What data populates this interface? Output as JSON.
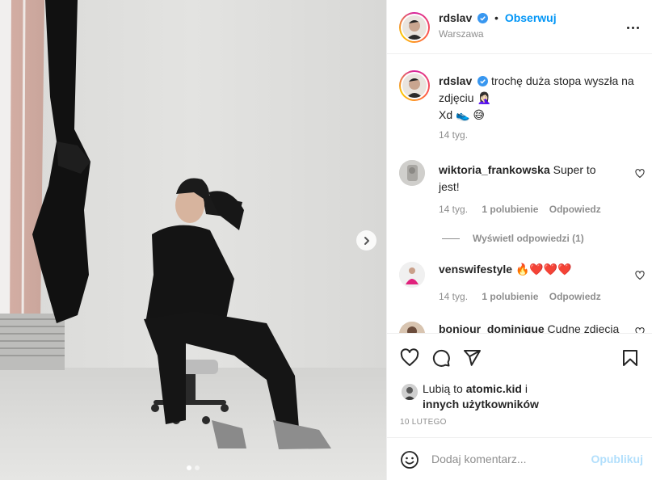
{
  "post": {
    "author": {
      "username": "rdslav",
      "verified": true,
      "follow_label": "Obserwuj",
      "separator": "•",
      "location": "Warszawa"
    },
    "caption": {
      "username": "rdslav",
      "text_line1": "trochę duża stopa wyszła na",
      "text_line2": "zdjęciu 🤦🏻‍♀️",
      "text_line3": "Xd 👟 😅",
      "time": "14 tyg."
    },
    "comments": [
      {
        "username": "wiktoria_frankowska",
        "text_line1": "Super to",
        "text_line2": "jest!",
        "time": "14 tyg.",
        "likes": "1 polubienie",
        "reply_label": "Odpowiedz",
        "view_replies": "Wyświetl odpowiedzi (1)"
      },
      {
        "username": "venswifestyle",
        "text": "🔥❤️❤️❤️",
        "time": "14 tyg.",
        "likes": "1 polubienie",
        "reply_label": "Odpowiedz"
      },
      {
        "username": "bonjour_dominique",
        "text": "Cudne zdjęcia"
      }
    ],
    "likes": {
      "prefix": "Lubią to",
      "user": "atomic.kid",
      "conjunction": "i",
      "others": "innych użytkowników"
    },
    "date": "10 LUTEGO",
    "comment_box": {
      "placeholder": "Dodaj komentarz...",
      "publish_label": "Opublikuj"
    },
    "carousel": {
      "slide_count": 2,
      "active_slide": 1
    }
  },
  "icons": {
    "verified": "verified-badge-icon",
    "more": "more-options-icon",
    "like": "heart-icon",
    "comment": "comment-icon",
    "share": "share-paper-plane-icon",
    "save": "bookmark-icon",
    "emoji": "smiley-icon",
    "next": "chevron-right-icon"
  },
  "colors": {
    "accent_blue": "#0095f6",
    "publish_disabled": "#b2dffc",
    "muted_text": "#8e8e8e",
    "verified_blue": "#3897f0"
  }
}
